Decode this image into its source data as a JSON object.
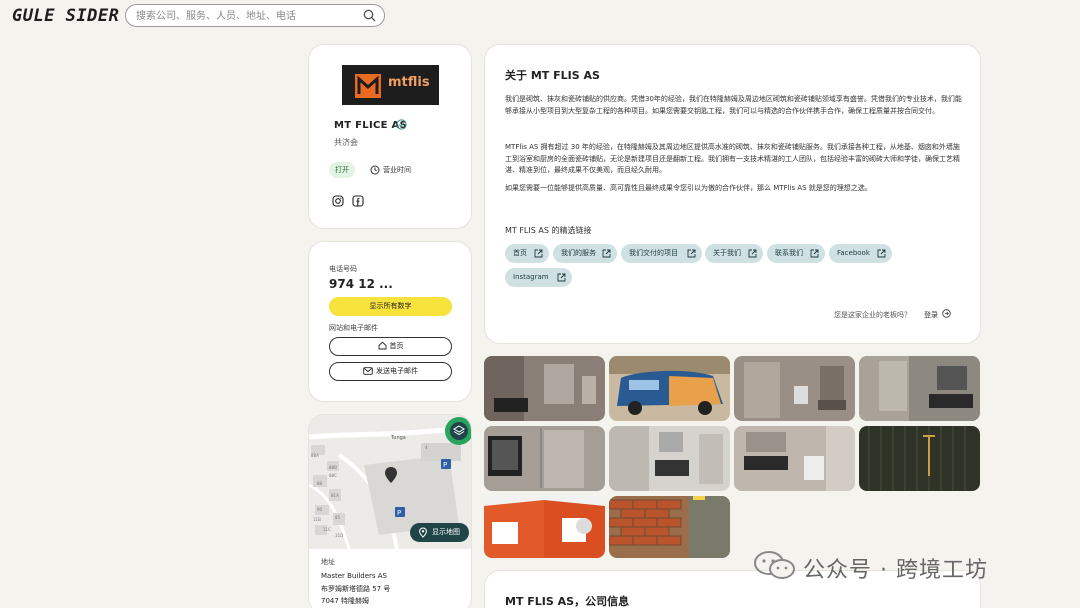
{
  "header": {
    "logo_text": "GULE SIDER",
    "search_placeholder": "搜索公司、服务、人员、地址、电话"
  },
  "profile": {
    "logo_text": "mtflis",
    "company_name": "MT FLICE AS",
    "city": "共济会",
    "status": "打开",
    "hours_label": "营业时间"
  },
  "contact": {
    "phone_label": "电话号码",
    "phone": "974 12 ...",
    "show_number": "显示所有数字",
    "web_label": "网站和电子邮件",
    "home_btn": "首页",
    "email_btn": "发送电子邮件"
  },
  "map": {
    "show_map": "显示地图",
    "labels": [
      "Tunga",
      "88A",
      "88B",
      "88C",
      "88",
      "81A",
      "90",
      "85",
      "11B",
      "11C",
      "11D",
      "4"
    ]
  },
  "address": {
    "label": "地址",
    "line1": "Master Builders AS",
    "line2": "布罗姆斯塔德路 57 号",
    "line3": "7047 特隆赫姆"
  },
  "about": {
    "title": "关于 MT FLIS AS",
    "p1": "我们是砌筑、抹灰和瓷砖铺贴的供应商。凭借30年的经验，我们在特隆赫姆及周边地区砌筑和瓷砖铺贴领域享有盛誉。凭借我们的专业技术，我们能够承接从小型项目到大型复杂工程的各种项目。如果您需要交钥匙工程，我们可以与精选的合作伙伴携手合作，确保工程质量并按合同交付。",
    "p2": "MTFlis AS 拥有超过 30 年的经验，在特隆赫姆及其周边地区提供高水准的砌筑、抹灰和瓷砖铺贴服务。我们承接各种工程，从地基、烟囱和外墙施工到浴室和厨房的全面瓷砖铺贴，无论是新建项目还是翻新工程。我们拥有一支技术精湛的工人团队，包括经验丰富的砌砖大师和学徒，确保工艺精湛、精准到位，最终成果不仅美观，而且经久耐用。",
    "p3": "如果您需要一位能够提供高质量、高可靠性且最终成果令您引以为傲的合作伙伴，那么 MTFlis AS 就是您的理想之选。",
    "links_title": "MT FLIS AS 的精选链接",
    "links": [
      "首页",
      "我们的服务",
      "我们交付的项目",
      "关于我们",
      "联系我们",
      "Facebook",
      "Instagram"
    ],
    "owner_question": "您是这家企业的老板吗？",
    "login": "登录"
  },
  "company_info": {
    "title": "MT FLIS AS，公司信息"
  },
  "watermark": {
    "text": "公众号 · 跨境工坊"
  },
  "colors": {
    "background": "#f5f3ee",
    "accent_yellow": "#f8e23c",
    "chip_bg": "#cfe1e3",
    "map_button": "#1f4548",
    "brand_orange": "#e86a23"
  }
}
